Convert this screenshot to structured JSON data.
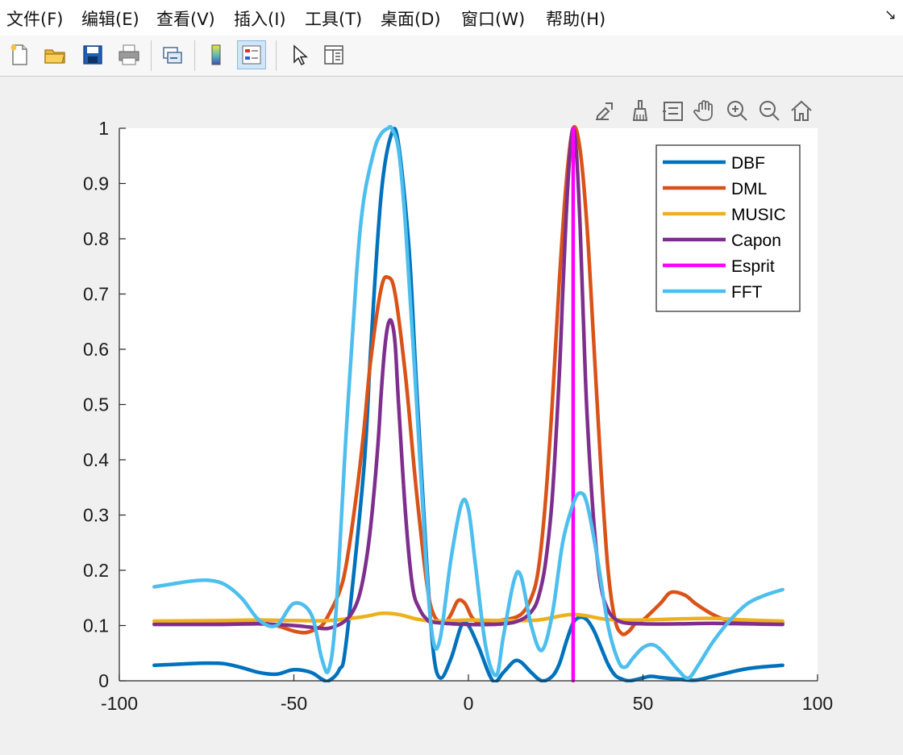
{
  "menubar": {
    "items": [
      {
        "label": "文件(F)"
      },
      {
        "label": "编辑(E)"
      },
      {
        "label": "查看(V)"
      },
      {
        "label": "插入(I)"
      },
      {
        "label": "工具(T)"
      },
      {
        "label": "桌面(D)"
      },
      {
        "label": "窗口(W)"
      },
      {
        "label": "帮助(H)"
      }
    ]
  },
  "toolbar": {
    "buttons": [
      "new-figure-icon",
      "open-file-icon",
      "save-icon",
      "print-icon",
      "link-plot-icon",
      "colorbar-icon",
      "legend-icon",
      "pointer-icon",
      "property-inspector-icon"
    ],
    "active": "legend-icon"
  },
  "axes_toolbar": {
    "buttons": [
      "export-icon",
      "brush-icon",
      "data-tips-icon",
      "pan-icon",
      "zoom-in-icon",
      "zoom-out-icon",
      "home-icon"
    ]
  },
  "chart_data": {
    "type": "line",
    "title": "",
    "xlabel": "",
    "ylabel": "",
    "xlim": [
      -100,
      100
    ],
    "ylim": [
      0,
      1
    ],
    "xticks": [
      -100,
      -50,
      0,
      50,
      100
    ],
    "xtick_labels": [
      "-100",
      "-50",
      "0",
      "50",
      "100"
    ],
    "yticks": [
      0,
      0.1,
      0.2,
      0.3,
      0.4,
      0.5,
      0.6,
      0.7,
      0.8,
      0.9,
      1
    ],
    "ytick_labels": [
      "0",
      "0.1",
      "0.2",
      "0.3",
      "0.4",
      "0.5",
      "0.6",
      "0.7",
      "0.8",
      "0.9",
      "1"
    ],
    "grid": false,
    "legend_position": "top-right",
    "series": [
      {
        "name": "DBF",
        "color": "#0072bd",
        "x": [
          -90,
          -80,
          -75,
          -70,
          -65,
          -60,
          -55,
          -50,
          -45,
          -42,
          -40,
          -37,
          -35,
          -30,
          -28,
          -25,
          -22,
          -20,
          -17,
          -15,
          -12,
          -10,
          -8,
          -5,
          -2,
          0,
          3,
          7,
          10,
          13,
          15,
          18,
          21,
          24,
          26,
          28,
          30,
          32,
          34,
          36,
          38,
          40,
          42,
          44,
          46,
          48,
          52,
          55,
          60,
          65,
          70,
          80,
          90
        ],
        "y": [
          0.028,
          0.031,
          0.032,
          0.031,
          0.024,
          0.015,
          0.012,
          0.02,
          0.015,
          0.003,
          0.0,
          0.02,
          0.07,
          0.38,
          0.6,
          0.88,
          0.99,
          0.97,
          0.78,
          0.55,
          0.22,
          0.05,
          0.005,
          0.04,
          0.1,
          0.1,
          0.06,
          0.0,
          0.015,
          0.035,
          0.034,
          0.015,
          0.0,
          0.008,
          0.03,
          0.07,
          0.105,
          0.115,
          0.11,
          0.09,
          0.06,
          0.03,
          0.01,
          0.003,
          0.0,
          0.002,
          0.008,
          0.006,
          0.003,
          0.001,
          0.008,
          0.022,
          0.028
        ]
      },
      {
        "name": "DML",
        "color": "#d95319",
        "x": [
          -90,
          -80,
          -70,
          -60,
          -55,
          -50,
          -47,
          -45,
          -42,
          -40,
          -37,
          -35,
          -32,
          -30,
          -28,
          -25,
          -23,
          -21,
          -18,
          -15,
          -12,
          -10,
          -7,
          -5,
          -3,
          -1,
          1,
          3,
          5,
          10,
          15,
          18,
          20,
          22,
          24,
          26,
          28,
          30,
          32,
          34,
          36,
          38,
          40,
          42,
          44,
          46,
          48,
          50,
          55,
          58,
          62,
          65,
          70,
          75,
          80,
          85,
          90
        ],
        "y": [
          0.103,
          0.104,
          0.106,
          0.105,
          0.1,
          0.09,
          0.087,
          0.09,
          0.1,
          0.12,
          0.16,
          0.21,
          0.34,
          0.45,
          0.58,
          0.71,
          0.73,
          0.7,
          0.55,
          0.35,
          0.18,
          0.12,
          0.105,
          0.12,
          0.145,
          0.14,
          0.115,
          0.105,
          0.108,
          0.11,
          0.12,
          0.15,
          0.2,
          0.32,
          0.5,
          0.72,
          0.9,
          1.0,
          0.96,
          0.82,
          0.6,
          0.38,
          0.2,
          0.11,
          0.085,
          0.09,
          0.105,
          0.11,
          0.14,
          0.16,
          0.155,
          0.14,
          0.12,
          0.108,
          0.105,
          0.105,
          0.105
        ]
      },
      {
        "name": "MUSIC",
        "color": "#edb120",
        "x": [
          -90,
          -70,
          -60,
          -50,
          -40,
          -30,
          -25,
          -20,
          -15,
          -10,
          0,
          10,
          20,
          30,
          40,
          50,
          60,
          70,
          80,
          90
        ],
        "y": [
          0.108,
          0.109,
          0.11,
          0.109,
          0.109,
          0.116,
          0.122,
          0.12,
          0.112,
          0.108,
          0.11,
          0.109,
          0.11,
          0.12,
          0.111,
          0.11,
          0.112,
          0.113,
          0.11,
          0.108
        ],
        "marker": "none"
      },
      {
        "name": "Capon",
        "color": "#7e2f8e",
        "x": [
          -90,
          -70,
          -60,
          -50,
          -45,
          -40,
          -35,
          -32,
          -30,
          -28,
          -26,
          -25,
          -24,
          -23,
          -22,
          -21,
          -20,
          -18,
          -16,
          -14,
          -12,
          -10,
          0,
          10,
          15,
          18,
          20,
          22,
          24,
          26,
          27,
          28,
          29,
          30,
          31,
          32,
          33,
          34,
          36,
          38,
          40,
          42,
          44,
          46,
          50,
          60,
          70,
          80,
          90
        ],
        "y": [
          0.102,
          0.102,
          0.103,
          0.1,
          0.097,
          0.095,
          0.11,
          0.14,
          0.19,
          0.28,
          0.42,
          0.52,
          0.6,
          0.645,
          0.65,
          0.61,
          0.5,
          0.3,
          0.17,
          0.13,
          0.112,
          0.106,
          0.102,
          0.103,
          0.11,
          0.125,
          0.15,
          0.21,
          0.33,
          0.55,
          0.7,
          0.84,
          0.95,
          1.0,
          0.95,
          0.82,
          0.64,
          0.48,
          0.28,
          0.17,
          0.128,
          0.112,
          0.106,
          0.104,
          0.103,
          0.103,
          0.104,
          0.103,
          0.102
        ]
      },
      {
        "name": "Esprit",
        "color": "#ff00ff",
        "x": [
          30,
          30
        ],
        "y": [
          0,
          1
        ]
      },
      {
        "name": "FFT",
        "color": "#4dbeee",
        "x": [
          -90,
          -85,
          -80,
          -75,
          -70,
          -65,
          -60,
          -55,
          -50,
          -45,
          -42,
          -40,
          -38,
          -35,
          -32,
          -30,
          -27,
          -25,
          -23,
          -22,
          -20,
          -18,
          -15,
          -12,
          -10,
          -8,
          -5,
          -2,
          0,
          2,
          5,
          8,
          10,
          13,
          15,
          18,
          21,
          24,
          27,
          30,
          32,
          34,
          37,
          40,
          43,
          45,
          47,
          50,
          53,
          56,
          60,
          63,
          66,
          70,
          75,
          80,
          85,
          90
        ],
        "y": [
          0.17,
          0.175,
          0.18,
          0.182,
          0.175,
          0.15,
          0.11,
          0.1,
          0.14,
          0.12,
          0.04,
          0.02,
          0.12,
          0.45,
          0.74,
          0.87,
          0.96,
          0.99,
          1.0,
          1.0,
          0.96,
          0.82,
          0.52,
          0.2,
          0.07,
          0.08,
          0.22,
          0.32,
          0.31,
          0.21,
          0.06,
          0.01,
          0.08,
          0.18,
          0.19,
          0.1,
          0.055,
          0.12,
          0.25,
          0.32,
          0.34,
          0.32,
          0.22,
          0.1,
          0.035,
          0.025,
          0.04,
          0.06,
          0.065,
          0.05,
          0.02,
          0.005,
          0.03,
          0.07,
          0.11,
          0.14,
          0.155,
          0.165
        ]
      }
    ]
  }
}
